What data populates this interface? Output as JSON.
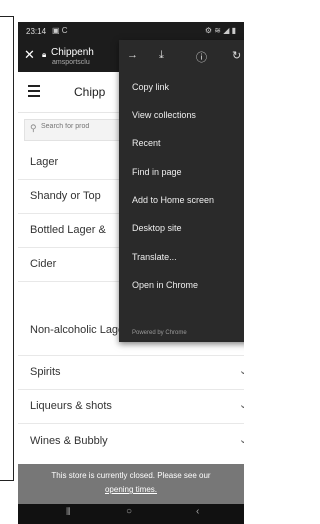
{
  "status_bar": {
    "time": "23:14",
    "left_icons": "▣ C",
    "right_icons": "⚙ ≋ ◢ ▮"
  },
  "custom_tab": {
    "close_icon": "close-icon",
    "title": "Chippenh",
    "url": "amsportsclu"
  },
  "site": {
    "name": "Chipp",
    "search_placeholder": "Search for prod"
  },
  "categories": [
    {
      "label": "Lager"
    },
    {
      "label": "Shandy or Top"
    },
    {
      "label": "Bottled Lager &"
    },
    {
      "label": "Cider"
    },
    {
      "label": "Non-alcoholic Lager & Ci"
    },
    {
      "label": "Spirits"
    },
    {
      "label": "Liqueurs & shots"
    },
    {
      "label": "Wines & Bubbly"
    }
  ],
  "menu": {
    "icons": [
      "forward-icon",
      "download-icon",
      "info-icon",
      "refresh-icon"
    ],
    "items": [
      {
        "label": "Copy link"
      },
      {
        "label": "View collections"
      },
      {
        "label": "Recent"
      },
      {
        "label": "Find in page"
      },
      {
        "label": "Add to Home screen"
      },
      {
        "label": "Desktop site"
      },
      {
        "label": "Translate..."
      },
      {
        "label": "Open in Chrome"
      }
    ],
    "footer": "Powered by Chrome"
  },
  "banner": {
    "line1": "This store is currently closed. Please see our",
    "line2": "opening times."
  },
  "colors": {
    "menu_bg": "#2a2a2a",
    "banner_bg": "#777777",
    "status_bg": "#1c1c1c"
  }
}
